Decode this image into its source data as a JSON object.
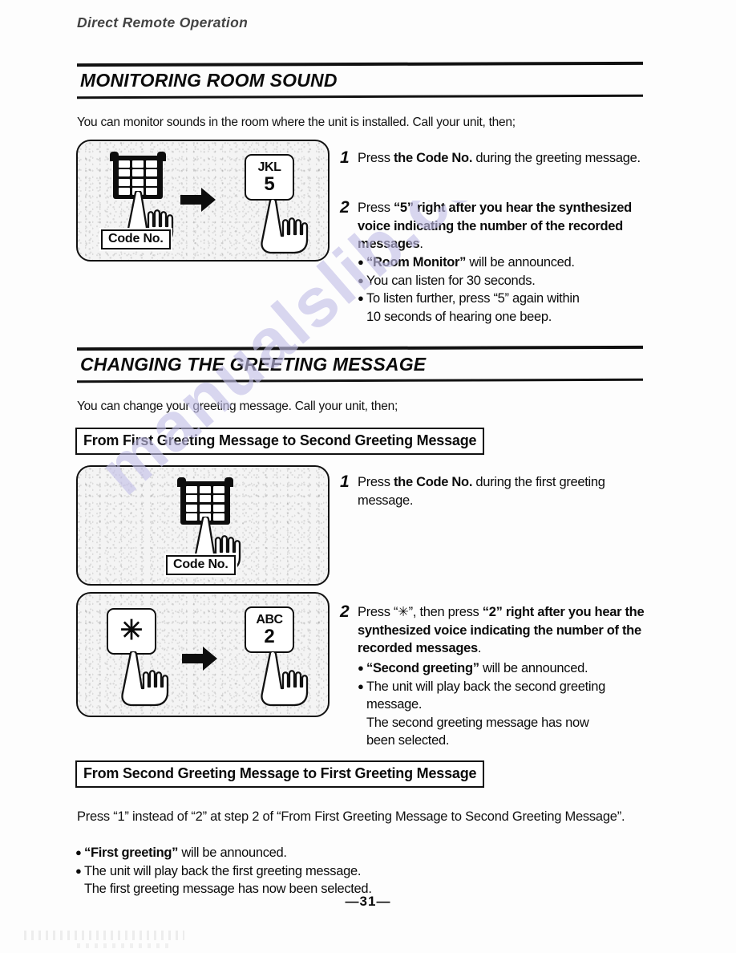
{
  "running_head": "Direct Remote Operation",
  "page_number": "—31—",
  "watermark": {
    "text": "manualslib.com",
    "color": "#c3bfe8"
  },
  "sections": [
    {
      "title": "MONITORING ROOM SOUND",
      "intro": "You can monitor sounds in the room where the unit is installed.  Call your unit, then;",
      "illustration": {
        "keypad_caption": "Code No.",
        "arrow": "right-arrow",
        "key_letters": "JKL",
        "key_digit": "5"
      },
      "steps": [
        {
          "number": "1",
          "pre": "Press ",
          "bold": "the Code No.",
          "post": " during the greeting message."
        },
        {
          "number": "2",
          "pre": "Press ",
          "bold": "“5” right after you hear the synthesized voice indicating the number of the recorded messages",
          "post": "."
        }
      ],
      "bullets": [
        {
          "bold": "“Room Monitor”",
          "rest": " will be announced."
        },
        {
          "bold": "",
          "rest": "You can listen for 30 seconds."
        },
        {
          "bold": "",
          "rest": "To listen further, press “5” again within",
          "cont": "10 seconds of hearing one beep."
        }
      ]
    },
    {
      "title": "CHANGING THE GREETING MESSAGE",
      "intro": "You can change your greeting message. Call your unit, then;",
      "subhead_1": "From First Greeting Message to Second Greeting Message",
      "illustration_1": {
        "keypad_caption": "Code No."
      },
      "illustration_2": {
        "star_key": "✳",
        "arrow": "right-arrow",
        "key_letters": "ABC",
        "key_digit": "2"
      },
      "steps": [
        {
          "number": "1",
          "pre": "Press ",
          "bold": "the Code No.",
          "post": " during the first greeting message."
        },
        {
          "number": "2",
          "pre": "Press “✳”, then press ",
          "bold": "“2” right after you hear the synthesized voice indicating the number of the recorded messages",
          "post": "."
        }
      ],
      "bullets": [
        {
          "bold": "“Second greeting”",
          "rest": " will be announced."
        },
        {
          "bold": "",
          "rest": "The unit will play back the second greeting",
          "cont": "message.",
          "cont2": "The second greeting message has now",
          "cont3": "been selected."
        }
      ],
      "subhead_2": "From Second Greeting Message to First Greeting Message",
      "closing_paragraph": "Press “1” instead of “2” at step 2 of “From First Greeting Message to Second Greeting Message”.",
      "closing_bullets": [
        {
          "bold": "“First greeting”",
          "rest": " will be announced."
        },
        {
          "bold": "",
          "rest": "The unit will play back the first greeting message.",
          "cont": "The first greeting message has now been selected."
        }
      ]
    }
  ]
}
